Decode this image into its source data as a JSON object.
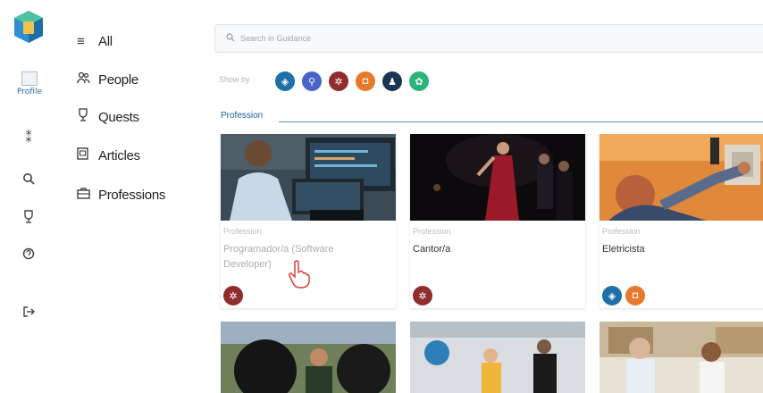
{
  "nav": {
    "profile_label": "Profile",
    "rail_icons": [
      "apps-icon",
      "search-icon",
      "trophy-icon",
      "help-icon",
      "logout-icon"
    ],
    "items": [
      {
        "label": "All",
        "icon": "list-icon"
      },
      {
        "label": "People",
        "icon": "people-icon"
      },
      {
        "label": "Quests",
        "icon": "trophy-icon"
      },
      {
        "label": "Articles",
        "icon": "article-icon"
      },
      {
        "label": "Professions",
        "icon": "briefcase-icon"
      }
    ]
  },
  "search": {
    "placeholder": "Search in Guidance"
  },
  "filters": {
    "label": "Show by",
    "chips": [
      {
        "name": "compass-filter",
        "color": "#1f6fa8"
      },
      {
        "name": "search-filter",
        "color": "#4b63c9"
      },
      {
        "name": "art-filter",
        "color": "#8f2d2d"
      },
      {
        "name": "shield-filter",
        "color": "#e8782a"
      },
      {
        "name": "person-filter",
        "color": "#1e3552"
      },
      {
        "name": "nature-filter",
        "color": "#2bb57a"
      }
    ]
  },
  "section": {
    "title": "Profession"
  },
  "cards": [
    {
      "kind": "Profession",
      "name": "Programador/a (Software Developer)",
      "tags": [
        "#8f2d2d"
      ]
    },
    {
      "kind": "Profession",
      "name": "Cantor/a",
      "tags": [
        "#8f2d2d"
      ]
    },
    {
      "kind": "Profession",
      "name": "Eletricista",
      "tags": [
        "#1f6fa8",
        "#e8782a"
      ]
    }
  ],
  "colors": {
    "accent": "#1f5d8e",
    "line": "#4d8fc4"
  }
}
